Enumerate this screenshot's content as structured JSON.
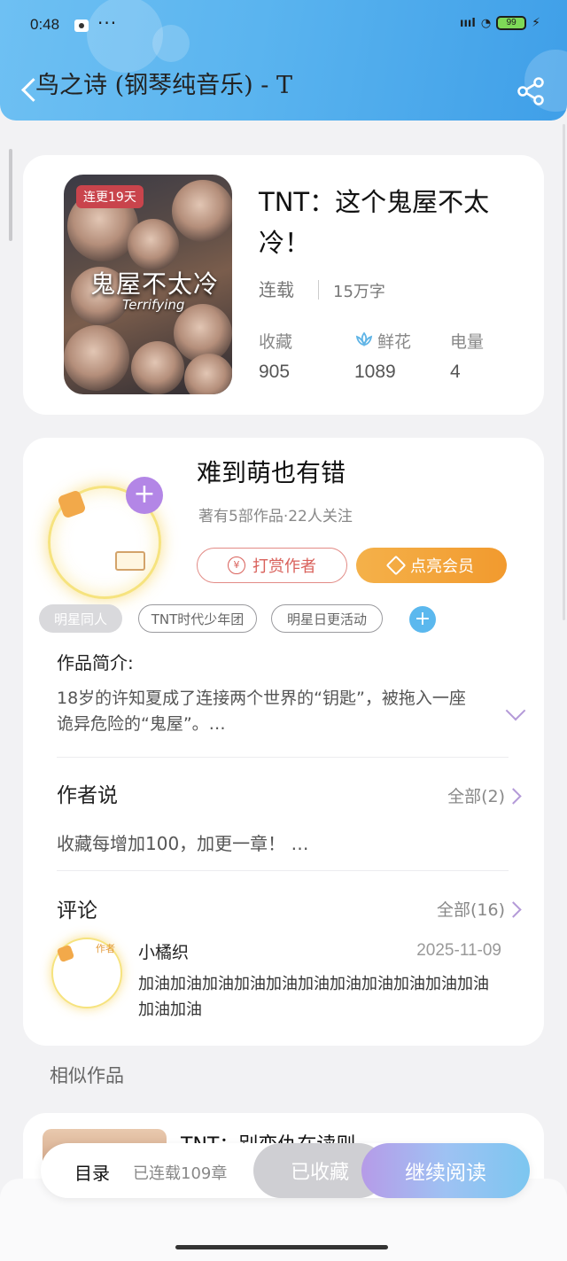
{
  "status_bar": {
    "time": "0:48",
    "dots": "···",
    "signal": "ıııl",
    "battery": "99"
  },
  "header": {
    "title": "鸟之诗 (钢琴纯音乐) - T"
  },
  "book": {
    "cover_badge": "连更19天",
    "cover_title": "鬼屋不太冷",
    "cover_subtitle": "Terrifying",
    "title": "TNT：这个鬼屋不太冷！",
    "status": "连载",
    "words": "15万字",
    "stats": [
      {
        "label": "收藏",
        "value": "905"
      },
      {
        "label": "鲜花",
        "value": "1089"
      },
      {
        "label": "电量",
        "value": "4"
      }
    ]
  },
  "author": {
    "name": "难到萌也有错",
    "meta": "著有5部作品·22人关注",
    "tip_label": "打赏作者",
    "tip_icon": "¥",
    "vip_label": "点亮会员",
    "plus": "+",
    "tags": [
      "明星同人",
      "TNT时代少年团",
      "明星日更活动"
    ],
    "tag_add": "+"
  },
  "intro": {
    "heading": "作品简介:",
    "text": "18岁的许知夏成了连接两个世界的“钥匙”，被拖入一座诡异危险的“鬼屋”。…"
  },
  "author_says": {
    "heading": "作者说",
    "all_label": "全部(2)",
    "text": "收藏每增加100，加更一章！ …"
  },
  "comments": {
    "heading": "评论",
    "all_label": "全部(16)",
    "items": [
      {
        "user": "小橘织",
        "avatar_tag": "作者",
        "date": "2025-11-09",
        "text": "加油加油加油加油加油加油加油加油加油加油加油加油加油"
      }
    ]
  },
  "similar": {
    "heading": "相似作品",
    "items": [
      {
        "title": "TNT：别恋仇在读则"
      }
    ]
  },
  "bottom_bar": {
    "toc_label": "目录",
    "chapters": "已连载109章",
    "fav_label": "已收藏",
    "read_label": "继续阅读"
  },
  "colors": {
    "header": "#5ab4ef",
    "accent_purple": "#b386e6",
    "vip_orange": "#f29a2e",
    "tip_red": "#d9615b"
  },
  "icons": [
    "back-arrow-icon",
    "share-icon",
    "flower-icon",
    "yen-icon",
    "diamond-icon",
    "plus-icon",
    "chevron-down-icon",
    "chevron-right-icon"
  ]
}
